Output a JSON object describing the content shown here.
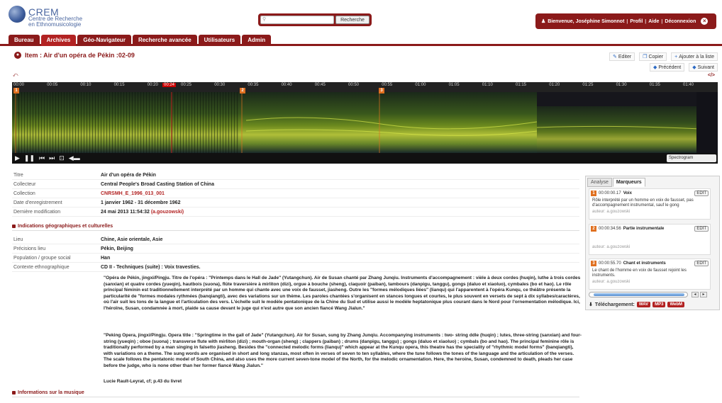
{
  "header": {
    "logo_title": "CREM",
    "logo_sub1": "Centre de Recherche",
    "logo_sub2": "en Ethnomusicologie",
    "search_placeholder": "",
    "search_button": "Recherche",
    "user_welcome": "Bienvenue, Joséphine Simonnot",
    "profile": "Profil",
    "help": "Aide",
    "logout": "Déconnexion"
  },
  "nav": [
    "Bureau",
    "Archives",
    "Géo-Navigateur",
    "Recherche avancée",
    "Utilisateurs",
    "Admin"
  ],
  "item": {
    "title": "Item : Air d'un opéra de Pékin :02-09",
    "edit": "Editer",
    "copy": "Copier",
    "add_list": "Ajouter à la liste",
    "previous": "Précédent",
    "next": "Suivant"
  },
  "player": {
    "embed_label": "</>",
    "cursor_time": "00:24",
    "ticks": [
      "00:00",
      "00:05",
      "00:10",
      "00:15",
      "00:20",
      "00:25",
      "00:30",
      "00:35",
      "00:40",
      "00:45",
      "00:50",
      "00:55",
      "01:00",
      "01:05",
      "01:10",
      "01:15",
      "01:20",
      "01:25",
      "01:30",
      "01:35",
      "01:40"
    ],
    "markers": [
      "1",
      "2",
      "3"
    ],
    "view_select": "Spectrogram",
    "icons": [
      "play-icon",
      "pause-icon",
      "rewind-icon",
      "forward-icon",
      "marker-add-icon",
      "volume-icon"
    ]
  },
  "meta": [
    {
      "label": "Titre",
      "value": "Air d'un opéra de Pékin",
      "red": false
    },
    {
      "label": "Collecteur",
      "value": "Central People's Broad Casting Station of China",
      "red": false
    },
    {
      "label": "Collection",
      "value": "CNRSMH_E_1996_013_001",
      "red": true
    },
    {
      "label": "Date d'enregistrement",
      "value": "1 janvier 1962 - 31 décembre 1962",
      "red": false
    },
    {
      "label": "Dernière modification",
      "value": "24 mai 2013 11:54:32",
      "author": "(a.gouzowski)",
      "red": false
    }
  ],
  "section_geo": "Indications géographiques et culturelles",
  "meta2": [
    {
      "label": "Lieu",
      "value": "Chine, Asie orientale, Asie"
    },
    {
      "label": "Précisions lieu",
      "value": "Pékin, Beijing"
    },
    {
      "label": "Population / groupe social",
      "value": "Han"
    },
    {
      "label": "Contexte ethnographique",
      "value": "CD II - Techniques (suite) : Voix travesties."
    }
  ],
  "desc_fr": "\"Opéra de Pékin, jingxi/Pingju. Titre de l'opéra : \"Printemps dans le Hall de Jade\" (Yutangchun). Air de Susan chanté par Zhang Junqiu. Instruments d'accompagnement : vièle à deux cordes (huqin), luthe à trois cordes (sanxian) et quatre cordes (yueqin), hautbois (suona), flûte traversière à mirliton (dizi), orgue à bouche (sheng), claquoir (paiban), tambours (danpigu, tanggu), gongs (daluo et xiaoluo), cymbales (bo et hao). Le rôle principal féminin est traditionnellement interprété par un homme qui chante avec une voix de fausset, jiasheng. Outre les \"formes mélodiques liées\" (lianqu) qui l'apparentent à l'opéra Kunqu, ce théâtre présente la particularité de \"formes modales rythmées (banqiangti), avec des variations sur un thème. Les paroles chantées s'organisent en stances longues et courtes, le plus souvent en versets de sept à dix syllabes/caractères, où l'air suit les tons de la langue et l'articulation des vers. L'échelle suit le modèle pentatonique de la Chine du Sud et utilise aussi le modèle heptatonique plus courant dans le Nord pour l'ornementation mélodique. Ici, l'héroïne, Susan, condamnée à mort, plaide sa cause devant le juge qui n'est autre que son ancien fiancé Wang Jialun.\"",
  "desc_en": "\"Peking Opera, jingxi/Pingju. Opera title : \"Springtime in the gall of Jade\" (Yutangchun). Air for Susan, sung by Zhang Junqiu. Accompanying instruments : two- string ddle (huqin) ; lutes, three-string (sanxian) and four-string (yueqin) ; oboe (suona) ; transverse flute with mirliton (dizi) ; mouth-organ (sheng) ; clappers (paiban) ; drums (danpigu, tanggu) ; gongs (daluo et xiaoluo) ; cymbals (bo and hao). The principal feminine rôle is traditionally performed by a man singing in falsetto jiasheng. Besides the \"connected melodic forms (lianqu)\" which appear at the Kunqu opera, this theatre has the speciality of \"rhythmic model forms\" (banqiangti), with variations on a theme. The sung words are organised in short and long stanzas, most often in verses of seven to ten syllables, where the tune follows the tones of the language and the articulation of the verses. The scale follows the pentatonic model of South China, and also uses the more current seven-tone model of the North, for the melodic ornamentation. Here, the heroine, Susan, condemned to death, pleads her case before the judge, who is none other than her former fiancé Wang Jialun.\"",
  "desc_credit": "Lucie Rault-Leyrat, cf; p.43 du livret",
  "section_music": "Informations sur la musique",
  "panel": {
    "tab_analysis": "Analyse",
    "tab_markers": "Marqueurs",
    "edit_label": "EDIT",
    "markers": [
      {
        "num": "1",
        "time": "00:00:00.17",
        "title": "Voix",
        "desc": "Rôle interprété par un homme en voix de fausset, pas d'accompagnement instrumental, sauf le gong",
        "author": "auteur: a.gouzowski"
      },
      {
        "num": "2",
        "time": "00:00:34.56",
        "title": "Partie instrumentale",
        "desc": "",
        "author": "auteur: a.gouzowski"
      },
      {
        "num": "3",
        "time": "00:00:55.70",
        "title": "Chant et instruments",
        "desc": "Le chant de l'homme en voix de fausset rejoint les instruments.",
        "author": "auteur: a.gouzowski"
      }
    ],
    "download_label": "Téléchargement:",
    "formats": [
      "WAV",
      "MP3",
      "WebM"
    ]
  },
  "colors": {
    "brand": "#8b1a1a",
    "marker": "#e07020",
    "link": "#2c6ac4"
  }
}
